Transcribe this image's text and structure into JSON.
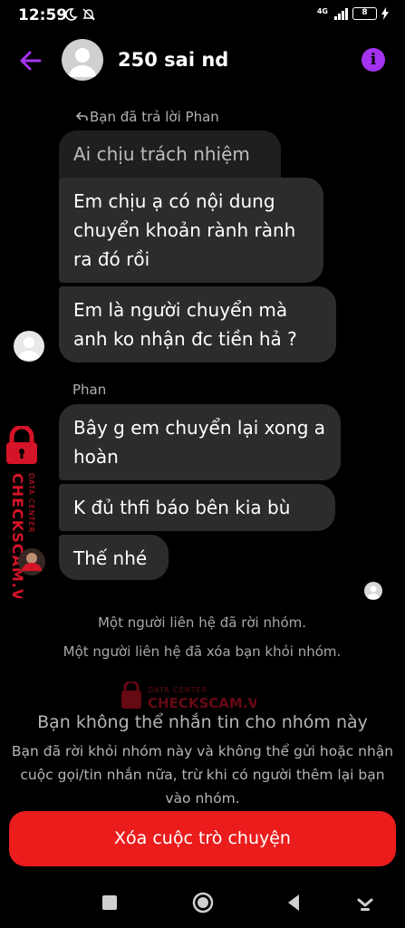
{
  "status_bar": {
    "time": "12:59",
    "network": "4G",
    "battery": "8"
  },
  "header": {
    "title": "250 sai nd"
  },
  "messages": {
    "reply_label": "Bạn đã trả lời Phan",
    "quoted": "Ai chịu trách nhiệm",
    "m1": "Em chịu ạ có nội dung chuyển khoản rành rành ra đó rồi",
    "m2": "Em là người chuyển mà anh ko nhận đc tiền hả ?",
    "sender": "Phan",
    "m3": "Bây g em chuyển lại xong a hoàn",
    "m4": "K đủ thfi báo bên kia bù",
    "m5": "Thế nhé"
  },
  "system": {
    "left_group": "Một người liên hệ đã rời nhóm.",
    "removed": "Một người liên hệ đã xóa bạn khỏi nhóm."
  },
  "blocked": {
    "title": "Bạn không thể nhắn tin cho nhóm này",
    "description": "Bạn đã rời khỏi nhóm này và không thể gửi hoặc nhận cuộc gọi/tin nhắn nữa, trừ khi có người thêm lại bạn vào nhóm."
  },
  "actions": {
    "delete_label": "Xóa cuộc trò chuyện"
  },
  "watermark": {
    "brand": "CHECKSCAM.VN",
    "tag": "DATA CENTER"
  },
  "colors": {
    "accent": "#a433f0",
    "bubble": "#2c2c2e",
    "danger": "#ea1c1c",
    "watermark": "#e0162b"
  }
}
